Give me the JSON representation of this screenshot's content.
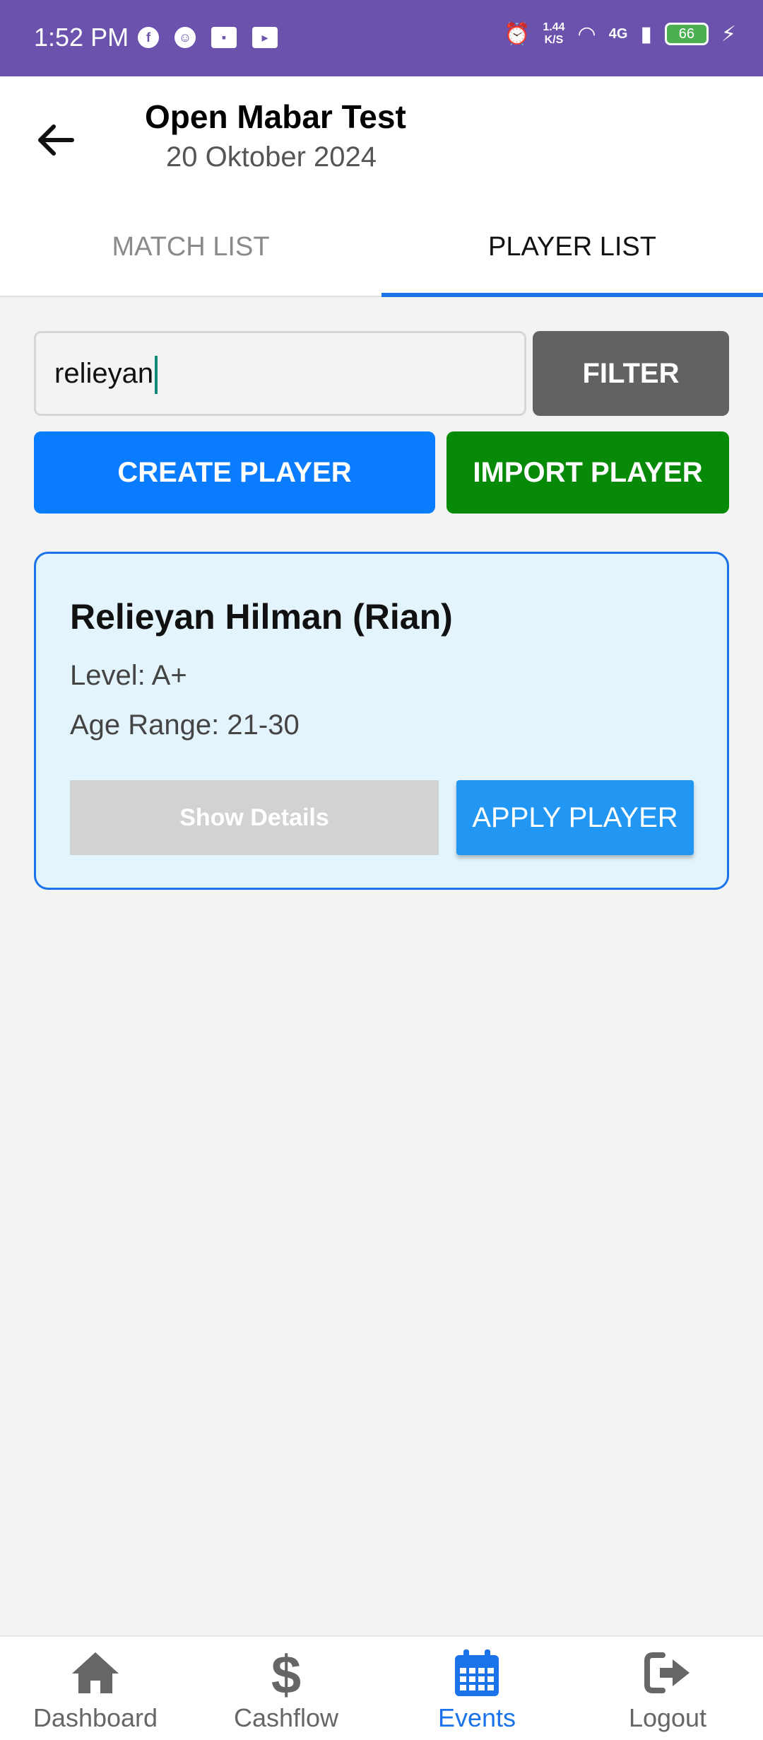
{
  "status_bar": {
    "time": "1:52 PM",
    "speed": "1.44\nK/S",
    "network": "4G",
    "battery": "66"
  },
  "header": {
    "title": "Open Mabar Test",
    "subtitle": "20 Oktober 2024"
  },
  "tabs": [
    {
      "label": "MATCH LIST",
      "active": false
    },
    {
      "label": "PLAYER LIST",
      "active": true
    }
  ],
  "search": {
    "value": "relieyan",
    "filter_label": "FILTER"
  },
  "actions": {
    "create_label": "CREATE PLAYER",
    "import_label": "IMPORT PLAYER"
  },
  "player": {
    "name": "Relieyan Hilman (Rian)",
    "level": "Level: A+",
    "age_range": "Age Range: 21-30",
    "details_label": "Show Details",
    "apply_label": "APPLY PLAYER"
  },
  "bottom_nav": [
    {
      "label": "Dashboard",
      "icon": "home-icon",
      "active": false
    },
    {
      "label": "Cashflow",
      "icon": "dollar-icon",
      "active": false
    },
    {
      "label": "Events",
      "icon": "calendar-icon",
      "active": true
    },
    {
      "label": "Logout",
      "icon": "logout-icon",
      "active": false
    }
  ],
  "colors": {
    "status_bar": "#6a52ad",
    "accent": "#1a73e8",
    "create": "#0a7cff",
    "import": "#078a07",
    "filter": "#626262",
    "card_bg": "#e3f4fc"
  }
}
